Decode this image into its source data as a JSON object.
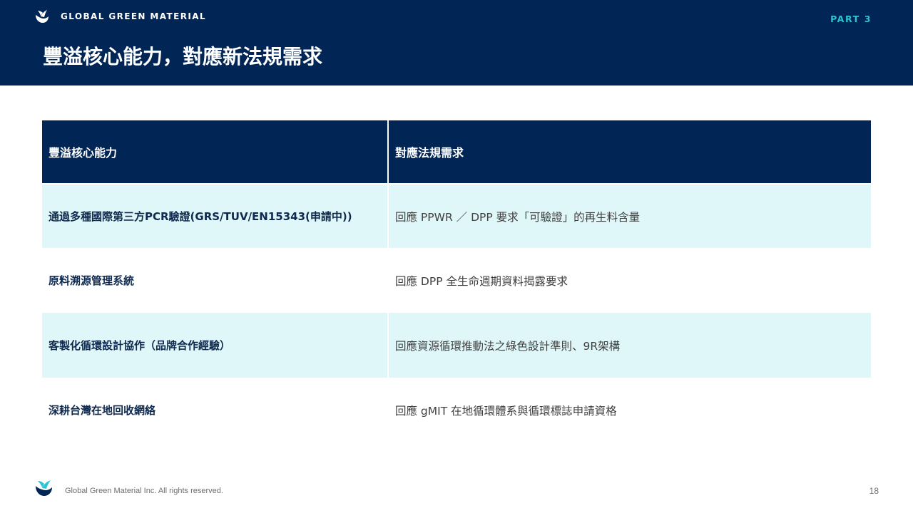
{
  "header": {
    "brand_name": "GLOBAL GREEN MATERIAL",
    "part_label": "PART 3",
    "title": "豐溢核心能力，對應新法規需求"
  },
  "table": {
    "headers": [
      "豐溢核心能力",
      "對應法規需求"
    ],
    "rows": [
      {
        "capability": "通過多種國際第三方PCR驗證(GRS/TUV/EN15343(申請中))",
        "requirement": "回應 PPWR ／ DPP 要求「可驗證」的再生料含量"
      },
      {
        "capability": "原料溯源管理系統",
        "requirement": "回應 DPP 全生命週期資料揭露要求"
      },
      {
        "capability": "客製化循環設計協作（品牌合作經驗）",
        "requirement": "回應資源循環推動法之綠色設計準則、9R架構"
      },
      {
        "capability": "深耕台灣在地回收網絡",
        "requirement": "回應 gMIT 在地循環體系與循環標誌申請資格"
      }
    ]
  },
  "footer": {
    "copyright": "Global Green Material Inc. All rights reserved.",
    "page_number": "18"
  },
  "colors": {
    "navy": "#012554",
    "accent": "#2ec4d3",
    "row_shade": "#e0f7f9"
  },
  "icons": [
    "brand-logo-icon",
    "footer-logo-icon"
  ]
}
